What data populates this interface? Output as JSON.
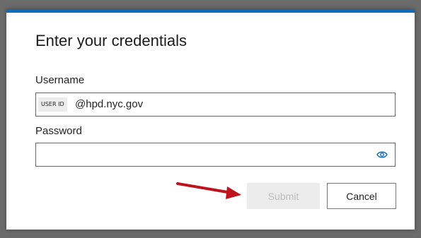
{
  "dialog": {
    "title": "Enter your credentials",
    "username_label": "Username",
    "username_prefix": "USER ID",
    "username_value": "@hpd.nyc.gov",
    "password_label": "Password",
    "password_value": "",
    "password_icon": "eye-icon",
    "submit_label": "Submit",
    "cancel_label": "Cancel"
  },
  "annotation": {
    "icon": "arrow-right",
    "color": "#c0121a"
  },
  "colors": {
    "accent": "#0f6cbd",
    "backdrop": "#6b6b6b",
    "disabled_bg": "#ececec"
  }
}
